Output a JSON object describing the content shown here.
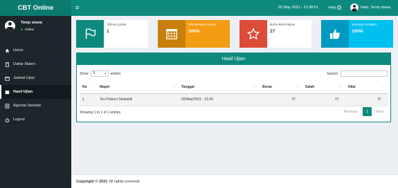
{
  "app": {
    "title": "CBT Online"
  },
  "header": {
    "datetime": "02 May 2021 - 21:38:51",
    "help": "Help",
    "user_greeting": "Halo, Temp siswa"
  },
  "sidebar": {
    "user_name": "Temp siswa",
    "status": "Online",
    "items": [
      {
        "label": "Home",
        "icon": "home-icon"
      },
      {
        "label": "Daftar Materi",
        "icon": "book-icon"
      },
      {
        "label": "Jadwal Ujian",
        "icon": "calendar-icon"
      },
      {
        "label": "Hasil Ujian",
        "icon": "book-icon",
        "active": true
      },
      {
        "label": "Agenda Sekolah",
        "icon": "list-icon"
      },
      {
        "label": "Logout",
        "icon": "power-icon"
      }
    ]
  },
  "stats": [
    {
      "label": "TOTAL UJIAN",
      "value": "1",
      "icon": "flag-icon",
      "color": "#0d8a7d"
    },
    {
      "label": "PROGRESS UJIAN",
      "value": "100%",
      "icon": "calendar-grid-icon",
      "color": "#f39c12"
    },
    {
      "label": "RATA-RATA NILAI",
      "value": "27",
      "icon": "star-icon",
      "color": "#dd4b39"
    },
    {
      "label": "SUKSES SUBMIT",
      "value": "100%",
      "icon": "thumbs-up-icon",
      "color": "#00c0ef"
    }
  ],
  "results": {
    "title": "Hasil Ujian",
    "show_label": "Show",
    "show_value": "5",
    "entries_label": "entries",
    "search_label": "Search:",
    "columns": [
      "No",
      "Mapel",
      "Tanggal",
      "Benar",
      "Salah",
      "Nilai"
    ],
    "rows": [
      {
        "no": "1",
        "mapel": "Tes Potensi Skolastik",
        "tanggal": "02/May/2021 - 21:00",
        "benar": "27",
        "salah": "73",
        "nilai": "27"
      }
    ],
    "info": "Showing 1 to 1 of 1 entries",
    "prev": "Previous",
    "page": "1",
    "next": "Next"
  },
  "footer": {
    "copyright": "Copyright © 2021",
    "rights": "All rights reserved."
  }
}
